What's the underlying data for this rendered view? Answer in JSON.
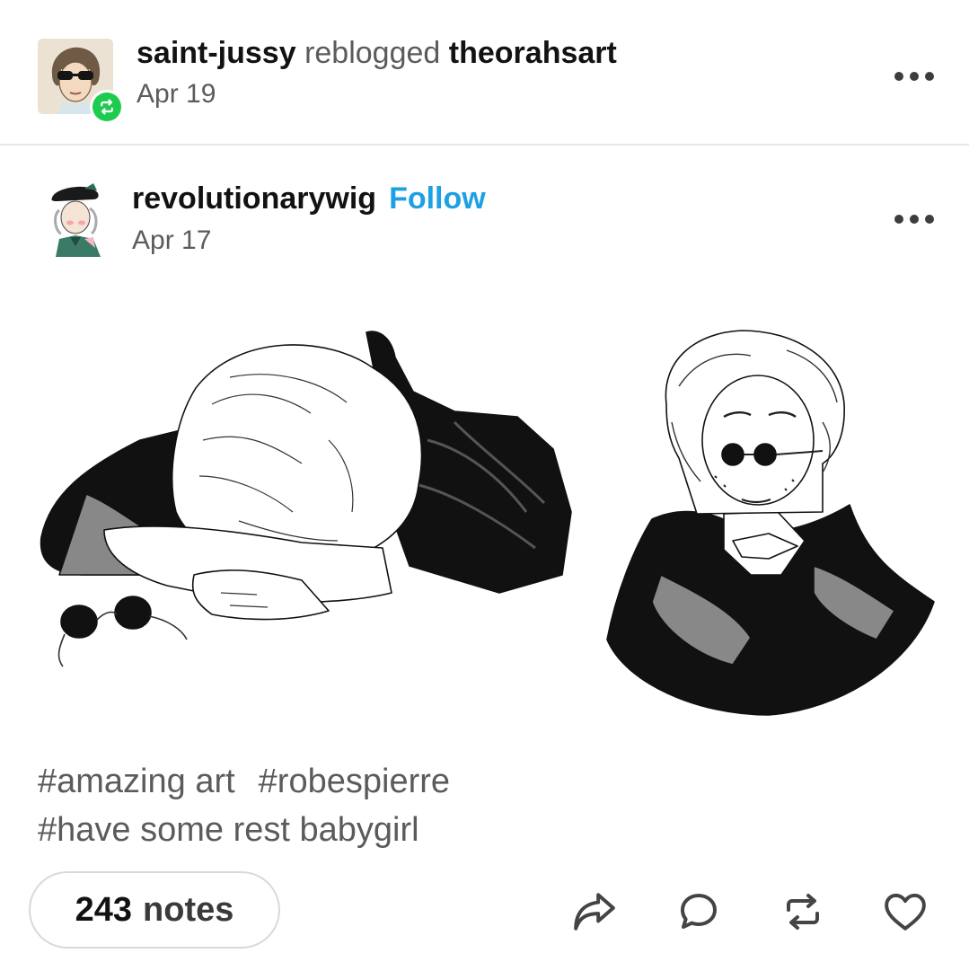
{
  "reblog": {
    "reblogger": "saint-jussy",
    "action_text": "reblogged",
    "source": "theorahsart",
    "date": "Apr 19"
  },
  "post": {
    "author": "revolutionarywig",
    "follow_label": "Follow",
    "date": "Apr 17",
    "tags": [
      "#amazing art",
      "#robespierre",
      "#have some rest babygirl"
    ],
    "notes_count": "243",
    "notes_label": "notes"
  },
  "icons": {
    "more": "more-dots-icon",
    "reblog_badge": "reblog-icon",
    "share": "share-icon",
    "reply": "reply-icon",
    "reblog": "reblog-icon",
    "like": "heart-icon"
  },
  "colors": {
    "follow": "#1da1e2",
    "reblog_badge": "#1ecb4f"
  }
}
